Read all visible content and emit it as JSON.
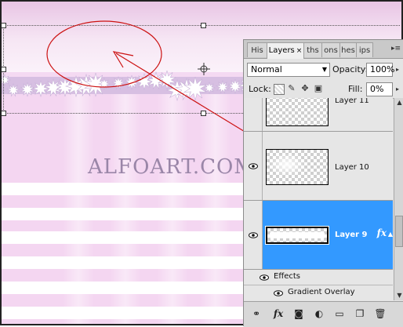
{
  "canvas": {
    "watermark": "ALFOART.COM"
  },
  "panel": {
    "tabs": [
      {
        "label": "His",
        "active": false
      },
      {
        "label": "Layers",
        "active": true,
        "close": "×"
      },
      {
        "label": "ths",
        "active": false
      },
      {
        "label": "ons",
        "active": false
      },
      {
        "label": "hes",
        "active": false
      },
      {
        "label": "ips",
        "active": false
      }
    ],
    "blend_mode": "Normal",
    "opacity_label": "Opacity:",
    "opacity_value": "100%",
    "lock_label": "Lock:",
    "fill_label": "Fill:",
    "fill_value": "0%",
    "layers": [
      {
        "name": "Layer 11",
        "visible": false,
        "selected": false
      },
      {
        "name": "Layer 10",
        "visible": true,
        "selected": false
      },
      {
        "name": "Layer 9",
        "visible": true,
        "selected": true,
        "fx": "fx"
      }
    ],
    "effects_label": "Effects",
    "effect_item": "Gradient Overlay"
  },
  "colors": {
    "selection": "#3399ff",
    "annotation": "#cc1111",
    "canvas_pink": "#f4d6f1"
  },
  "icons": [
    "eye-icon",
    "link-icon",
    "fx-icon",
    "mask-icon",
    "adjustment-icon",
    "folder-icon",
    "new-layer-icon",
    "trash-icon"
  ]
}
